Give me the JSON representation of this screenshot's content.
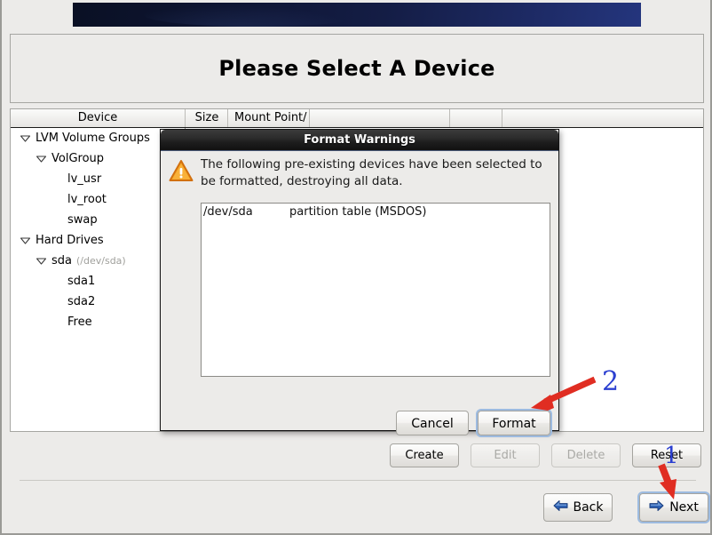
{
  "window": {
    "title": "Please Select A Device"
  },
  "table": {
    "columns": [
      "Device",
      "Size",
      "Mount Point/",
      "",
      "",
      ""
    ]
  },
  "tree": {
    "items": [
      {
        "label": "LVM Volume Groups",
        "sub": "",
        "indent": 0,
        "expander": "expanded"
      },
      {
        "label": "VolGroup",
        "sub": "",
        "indent": 1,
        "expander": "expanded"
      },
      {
        "label": "lv_usr",
        "sub": "",
        "indent": 2,
        "expander": "none"
      },
      {
        "label": "lv_root",
        "sub": "",
        "indent": 2,
        "expander": "none"
      },
      {
        "label": "swap",
        "sub": "",
        "indent": 2,
        "expander": "none"
      },
      {
        "label": "Hard Drives",
        "sub": "",
        "indent": 0,
        "expander": "expanded"
      },
      {
        "label": "sda",
        "sub": "(/dev/sda)",
        "indent": 1,
        "expander": "expanded"
      },
      {
        "label": "sda1",
        "sub": "",
        "indent": 2,
        "expander": "none"
      },
      {
        "label": "sda2",
        "sub": "",
        "indent": 2,
        "expander": "none"
      },
      {
        "label": "Free",
        "sub": "",
        "indent": 2,
        "expander": "none"
      }
    ]
  },
  "actions": {
    "create": "Create",
    "edit": "Edit",
    "delete": "Delete",
    "reset": "Reset"
  },
  "nav": {
    "back": "Back",
    "next": "Next"
  },
  "dialog": {
    "title": "Format Warnings",
    "message": "The following pre-existing devices have been selected to be formatted, destroying all data.",
    "entries": [
      "/dev/sda          partition table (MSDOS)"
    ],
    "cancel": "Cancel",
    "format": "Format"
  },
  "annotations": {
    "step1": "1",
    "step2": "2"
  },
  "colors": {
    "accent_blue": "#2b3fd0",
    "arrow_red": "#e02d22",
    "banner_navy": "#141d45",
    "warning_orange": "#f0941e",
    "focus_ring": "#9dbbe0"
  }
}
